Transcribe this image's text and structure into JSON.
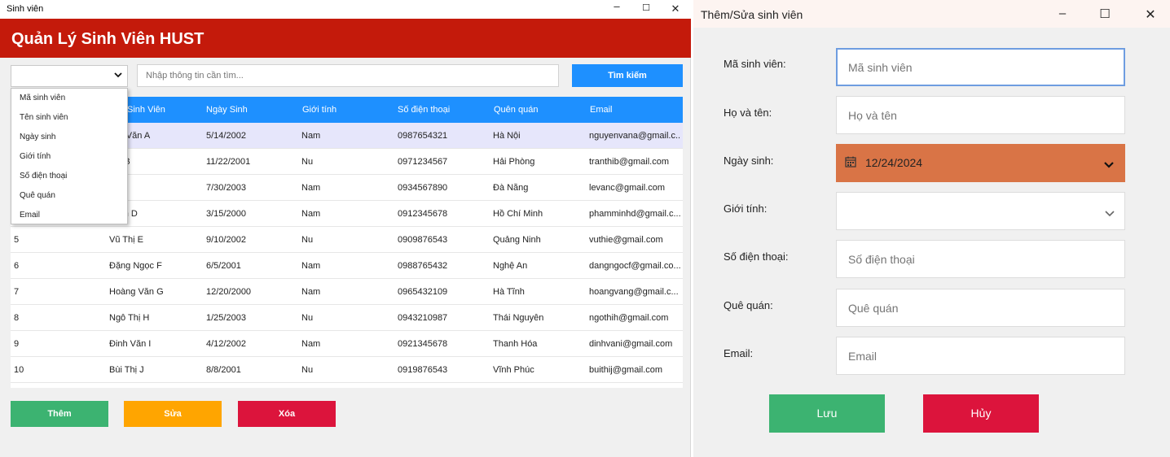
{
  "main_window": {
    "title": "Sinh viên",
    "controls": {
      "minimize": "–",
      "maximize": "☐",
      "close": "✕"
    },
    "header_title": "Quản Lý Sinh Viên HUST",
    "search": {
      "combo_value": "",
      "placeholder": "Nhập thông tin cần tìm...",
      "button_label": "Tìm kiếm"
    },
    "dropdown_options": [
      "Mã sinh viên",
      "Tên sinh viên",
      "Ngày sinh",
      "Giới tính",
      "Số điện thoại",
      "Quê quán",
      "Email"
    ],
    "table": {
      "columns": [
        "Sinh Viên",
        "Ngày Sinh",
        "Giới tính",
        "Số điện thoại",
        "Quên quán",
        "Email"
      ],
      "rows": [
        {
          "id": "",
          "name": "yễn Văn A",
          "dob": "5/14/2002",
          "gender": "Nam",
          "phone": "0987654321",
          "home": "Hà Nội",
          "email": "nguyenvana@gmail.c..."
        },
        {
          "id": "",
          "name": "Thị B",
          "dob": "11/22/2001",
          "gender": "Nu",
          "phone": "0971234567",
          "home": "Hải Phòng",
          "email": "tranthib@gmail.com"
        },
        {
          "id": "",
          "name": "ăn C",
          "dob": "7/30/2003",
          "gender": "Nam",
          "phone": "0934567890",
          "home": "Đà Nẵng",
          "email": "levanc@gmail.com"
        },
        {
          "id": "",
          "name": "Minh D",
          "dob": "3/15/2000",
          "gender": "Nam",
          "phone": "0912345678",
          "home": "Hồ Chí Minh",
          "email": "phamminhd@gmail.c..."
        },
        {
          "id": "5",
          "name": "Vũ Thị E",
          "dob": "9/10/2002",
          "gender": "Nu",
          "phone": "0909876543",
          "home": "Quảng Ninh",
          "email": "vuthie@gmail.com"
        },
        {
          "id": "6",
          "name": "Đặng Ngọc F",
          "dob": "6/5/2001",
          "gender": "Nam",
          "phone": "0988765432",
          "home": "Nghệ An",
          "email": "dangngocf@gmail.co..."
        },
        {
          "id": "7",
          "name": "Hoàng Văn G",
          "dob": "12/20/2000",
          "gender": "Nam",
          "phone": "0965432109",
          "home": "Hà Tĩnh",
          "email": "hoangvang@gmail.c..."
        },
        {
          "id": "8",
          "name": "Ngô Thị H",
          "dob": "1/25/2003",
          "gender": "Nu",
          "phone": "0943210987",
          "home": "Thái Nguyên",
          "email": "ngothih@gmail.com"
        },
        {
          "id": "9",
          "name": "Đinh Văn I",
          "dob": "4/12/2002",
          "gender": "Nam",
          "phone": "0921345678",
          "home": "Thanh Hóa",
          "email": "dinhvani@gmail.com"
        },
        {
          "id": "10",
          "name": "Bùi Thị J",
          "dob": "8/8/2001",
          "gender": "Nu",
          "phone": "0919876543",
          "home": "Vĩnh Phúc",
          "email": "buithij@gmail.com"
        }
      ]
    },
    "actions": {
      "add": "Thêm",
      "edit": "Sửa",
      "delete": "Xóa"
    }
  },
  "form_window": {
    "title": "Thêm/Sửa sinh viên",
    "controls": {
      "minimize": "–",
      "maximize": "☐",
      "close": "✕"
    },
    "fields": {
      "student_id": {
        "label": "Mã sinh viên:",
        "placeholder": "Mã sinh viên"
      },
      "full_name": {
        "label": "Họ và tên:",
        "placeholder": "Họ và tên"
      },
      "dob": {
        "label": "Ngày sinh:",
        "value": "12/24/2024"
      },
      "gender": {
        "label": "Giới tính:",
        "value": ""
      },
      "phone": {
        "label": "Số điện thoại:",
        "placeholder": "Số điện thoại"
      },
      "hometown": {
        "label": "Quê quán:",
        "placeholder": "Quê quán"
      },
      "email": {
        "label": "Email:",
        "placeholder": "Email"
      }
    },
    "buttons": {
      "save": "Lưu",
      "cancel": "Hủy"
    }
  },
  "colors": {
    "header_red": "#c41a0b",
    "accent_blue": "#1e90ff",
    "green": "#3cb371",
    "orange": "#ffa500",
    "crimson": "#dc143c",
    "date_orange": "#d97446"
  }
}
